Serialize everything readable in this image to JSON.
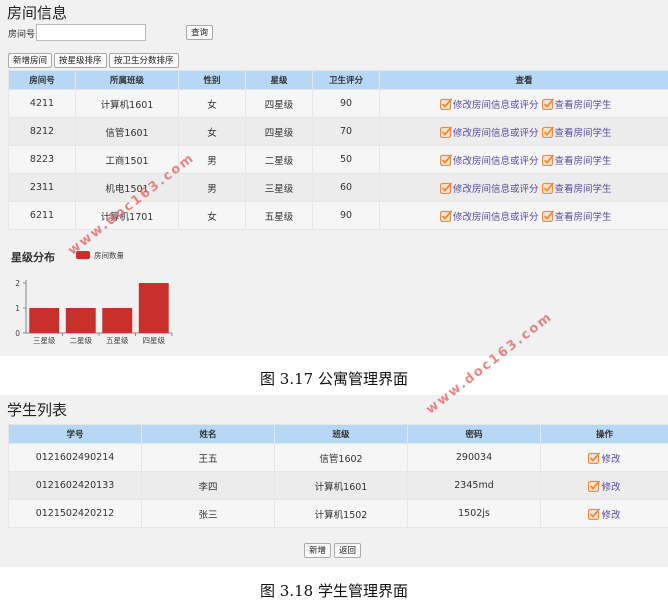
{
  "apartment": {
    "title": "房间信息",
    "search_label": "房间号:",
    "search_value": "",
    "query_button": "查询",
    "toolbar": [
      "新增房间",
      "按星级排序",
      "按卫生分数排序"
    ],
    "columns": [
      "房间号",
      "所属班级",
      "性别",
      "星级",
      "卫生评分",
      "查看"
    ],
    "rows": [
      [
        "4211",
        "计算机1601",
        "女",
        "四星级",
        "90"
      ],
      [
        "8212",
        "信管1601",
        "女",
        "四星级",
        "70"
      ],
      [
        "8223",
        "工商1501",
        "男",
        "二星级",
        "50"
      ],
      [
        "2311",
        "机电1501",
        "男",
        "三星级",
        "60"
      ],
      [
        "6211",
        "计算机1701",
        "女",
        "五星级",
        "90"
      ]
    ],
    "edit_action": "修改房间信息或评分",
    "view_action": "查看房间学生",
    "check_color": "#f08a3c"
  },
  "chart_title": "星级分布",
  "chart_data": {
    "type": "bar",
    "categories": [
      "三星级",
      "二星级",
      "五星级",
      "四星级"
    ],
    "series": [
      {
        "name": "房间数量",
        "values": [
          1,
          1,
          1,
          2
        ]
      }
    ],
    "ylim": [
      0,
      2
    ],
    "yticks": [
      "0",
      "1",
      "2"
    ],
    "legend": "top",
    "bar_color": "#c9302c"
  },
  "caption1": "图 3.17 公寓管理界面",
  "students": {
    "title": "学生列表",
    "columns": [
      "学号",
      "姓名",
      "班级",
      "密码",
      "操作"
    ],
    "rows": [
      [
        "0121602490214",
        "王五",
        "信管1602",
        "290034"
      ],
      [
        "0121602420133",
        "李四",
        "计算机1601",
        "2345md"
      ],
      [
        "0121502420212",
        "张三",
        "计算机1502",
        "1502js"
      ]
    ],
    "edit_action": "修改",
    "add_button": "新增",
    "back_button": "返回"
  },
  "caption2": "图 3.18 学生管理界面",
  "watermark": "www.doc163.com"
}
